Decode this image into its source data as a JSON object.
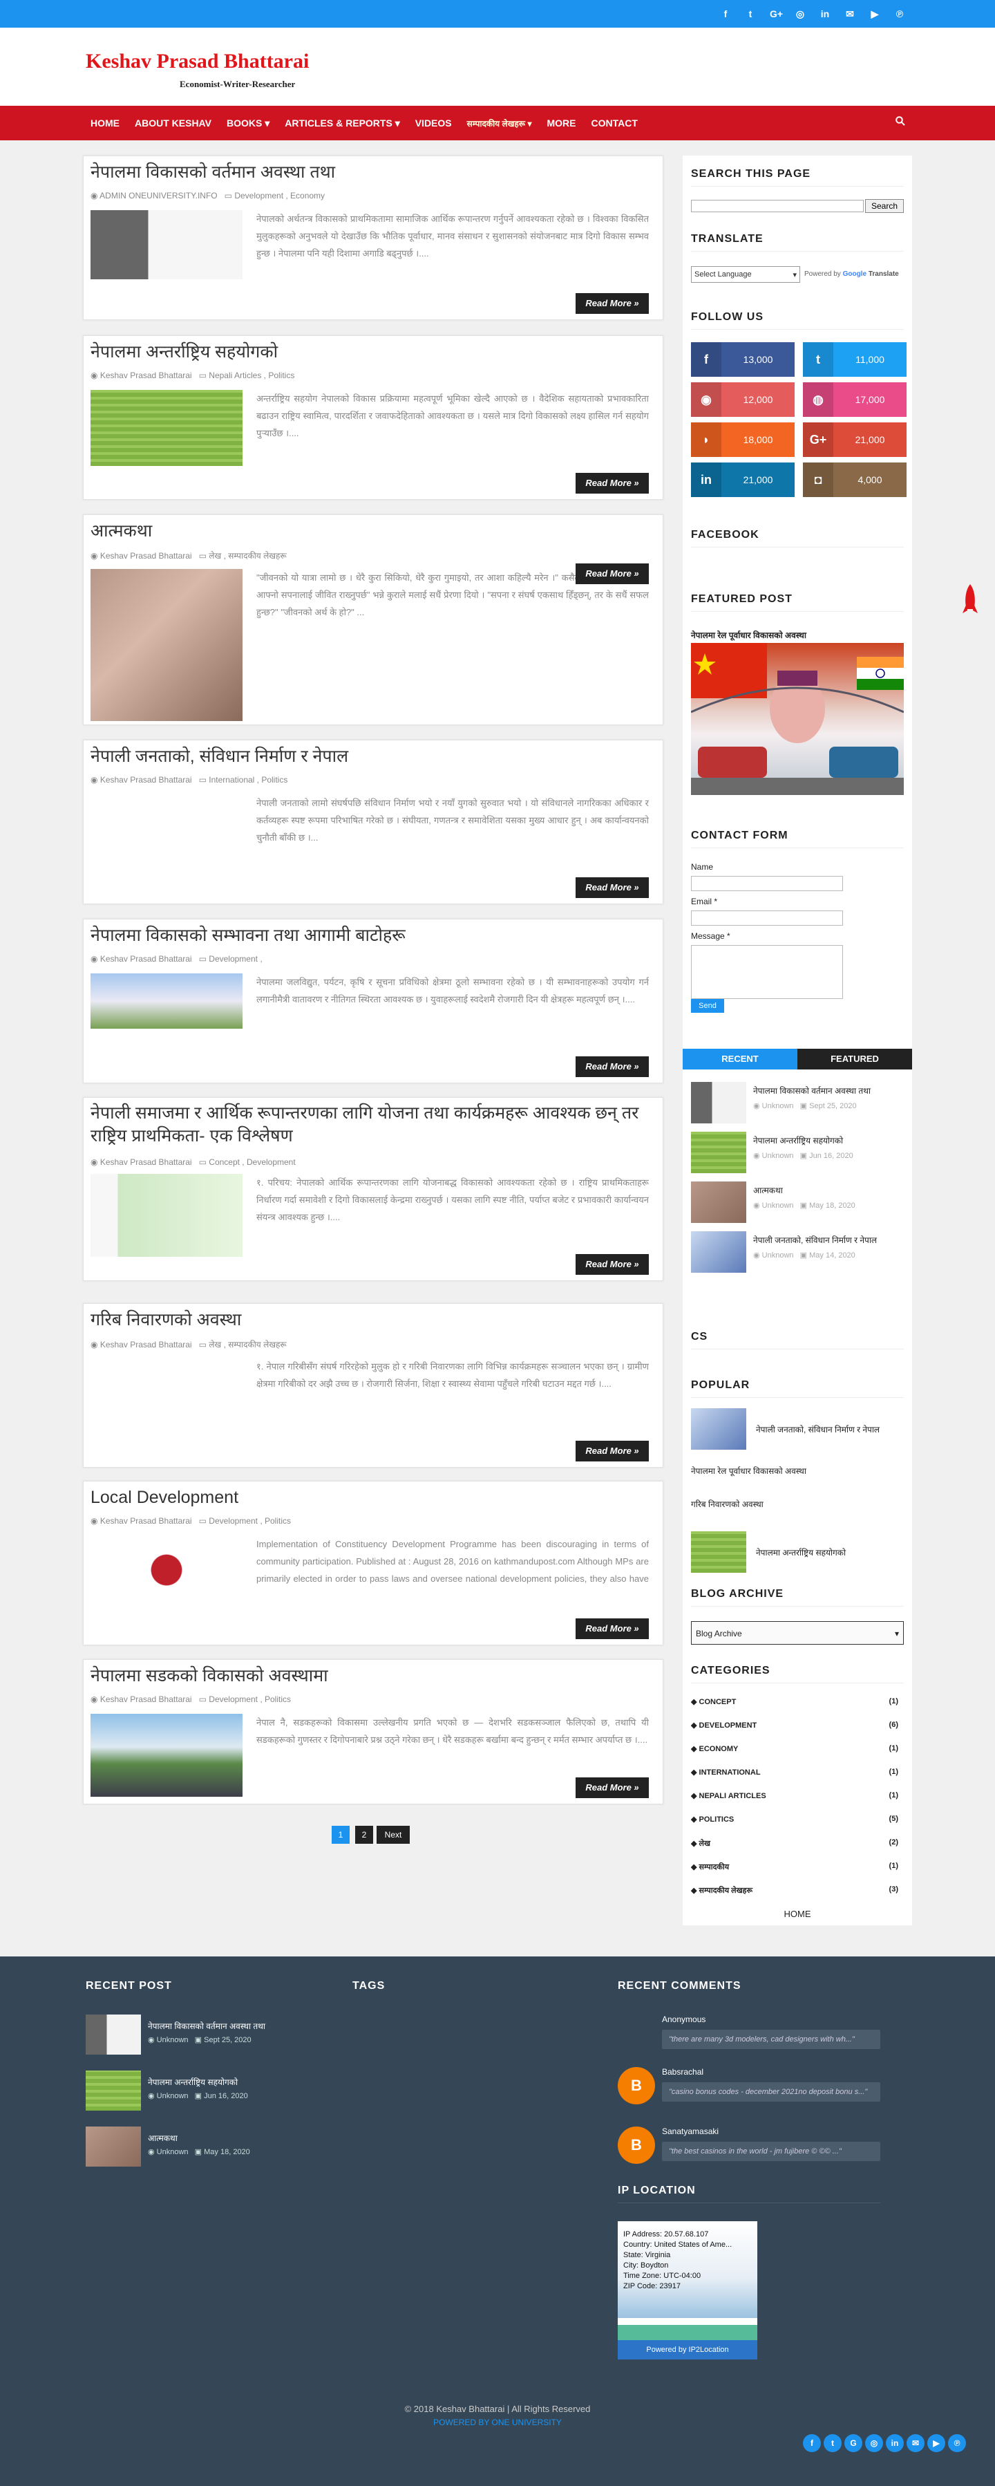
{
  "site": {
    "title": "Keshav Prasad Bhattarai",
    "subtitle": "Economist-Writer-Researcher"
  },
  "topbar_icons": [
    "facebook-icon",
    "twitter-icon",
    "google-plus-icon",
    "instagram-icon",
    "linkedin-icon",
    "email-icon",
    "youtube-icon",
    "pinterest-icon"
  ],
  "nav": [
    "HOME",
    "ABOUT KESHAV",
    "BOOKS ▾",
    "ARTICLES & REPORTS ▾",
    "VIDEOS",
    "सम्पादकीय लेखहरू ▾",
    "MORE",
    "CONTACT"
  ],
  "posts": [
    {
      "title": "नेपालमा विकासको वर्तमान अवस्था तथा",
      "meta_author": "ADMIN ONEUNIVERSITY.INFO",
      "meta_labels": "Development , Economy",
      "excerpt": "नेपालको अर्थतन्त्र विकासको प्राथमिकतामा सामाजिक आर्थिक रूपान्तरण गर्नुपर्ने आवश्यकता रहेको छ । विश्वका विकसित मुलुकहरूको अनुभवले यो देखाउँछ कि भौतिक पूर्वाधार, मानव संसाधन र सुशासनको संयोजनबाट मात्र दिगो विकास सम्भव हुन्छ । नेपालमा पनि यही दिशामा अगाडि बढ्नुपर्छ ।....",
      "read": "Read More »"
    },
    {
      "title": "नेपालमा अन्तर्राष्ट्रिय सहयोगको",
      "meta_author": "Keshav Prasad Bhattarai",
      "meta_labels": "Nepali Articles , Politics",
      "excerpt": "अन्तर्राष्ट्रिय सहयोग नेपालको विकास प्रक्रियामा महत्वपूर्ण भूमिका खेल्दै आएको छ । वैदेशिक सहायताको प्रभावकारिता बढाउन राष्ट्रिय स्वामित्व, पारदर्शिता र जवाफदेहिताको आवश्यकता छ । यसले मात्र दिगो विकासको लक्ष्य हासिल गर्न सहयोग पुर्‍याउँछ ।....",
      "read": "Read More »"
    },
    {
      "title": "आत्मकथा",
      "meta_author": "Keshav Prasad Bhattarai",
      "meta_labels": "लेख , सम्पादकीय लेखहरू",
      "excerpt": "\"जीवनको यो यात्रा लामो छ । धेरै कुरा सिकियो, धेरै कुरा गुमाइयो, तर आशा कहिल्यै मरेन ।\" कसैले भनेका थिए । \"हामी आफ्नो सपनालाई जीवित राख्नुपर्छ\" भन्ने कुराले मलाई सधैं प्रेरणा दियो । \"सपना र संघर्ष एकसाथ हिँड्छन्, तर के सधैं सफल हुन्छ?\" \"जीवनको अर्थ के हो?\" ...",
      "read": "Read More »"
    },
    {
      "title": "नेपाली जनताको, संविधान निर्माण र नेपाल",
      "meta_author": "Keshav Prasad Bhattarai",
      "meta_labels": "International , Politics",
      "excerpt": "नेपाली जनताको लामो संघर्षपछि संविधान निर्माण भयो र नयाँ युगको सुरुवात भयो । यो संविधानले नागरिकका अधिकार र कर्तव्यहरू स्पष्ट रूपमा परिभाषित गरेको छ । संघीयता, गणतन्त्र र समावेशिता यसका मुख्य आधार हुन् । अब कार्यान्वयनको चुनौती बाँकी छ ।...",
      "read": "Read More »"
    },
    {
      "title": "नेपालमा विकासको सम्भावना तथा आगामी बाटोहरू",
      "meta_author": "Keshav Prasad Bhattarai",
      "meta_labels": "Development ,",
      "excerpt": "नेपालमा जलविद्युत, पर्यटन, कृषि र सूचना प्रविधिको क्षेत्रमा ठूलो सम्भावना रहेको छ । यी सम्भावनाहरूको उपयोग गर्न लगानीमैत्री वातावरण र नीतिगत स्थिरता आवश्यक छ । युवाहरूलाई स्वदेशमै रोजगारी दिन यी क्षेत्रहरू महत्वपूर्ण छन् ।....",
      "read": "Read More »"
    },
    {
      "title": "नेपाली समाजमा र आर्थिक रूपान्तरणका लागि योजना तथा कार्यक्रमहरू आवश्यक छन् तर राष्ट्रिय प्राथमिकता- एक विश्लेषण",
      "meta_author": "Keshav Prasad Bhattarai",
      "meta_labels": "Concept , Development",
      "excerpt": "१. परिचय: नेपालको आर्थिक रूपान्तरणका लागि योजनाबद्ध विकासको आवश्यकता रहेको छ । राष्ट्रिय प्राथमिकताहरू निर्धारण गर्दा समावेशी र दिगो विकासलाई केन्द्रमा राख्नुपर्छ । यसका लागि स्पष्ट नीति, पर्याप्त बजेट र प्रभावकारी कार्यान्वयन संयन्त्र आवश्यक हुन्छ ।....",
      "read": "Read More »"
    },
    {
      "title": "गरिब निवारणको अवस्था",
      "meta_author": "Keshav Prasad Bhattarai",
      "meta_labels": "लेख , सम्पादकीय लेखहरू",
      "excerpt": "१. नेपाल गरिबीसँग संघर्ष गरिरहेको मुलुक हो र गरिबी निवारणका लागि विभिन्न कार्यक्रमहरू सञ्चालन भएका छन् । ग्रामीण क्षेत्रमा गरिबीको दर अझै उच्च छ । रोजगारी सिर्जना, शिक्षा र स्वास्थ्य सेवामा पहुँचले गरिबी घटाउन मद्दत गर्छ ।....",
      "read": "Read More »"
    },
    {
      "title": "Local Development",
      "meta_author": "Keshav Prasad Bhattarai",
      "meta_labels": "Development , Politics",
      "excerpt": "Implementation of Constituency Development Programme has been discouraging in terms of community participation. Published at : August 28, 2016 on kathmandupost.com Although MPs are primarily elected in order to pass laws and oversee national development policies, they also have some local responsibilities.....",
      "read": "Read More »"
    },
    {
      "title": "नेपालमा सडकको विकासको अवस्थामा",
      "meta_author": "Keshav Prasad Bhattarai",
      "meta_labels": "Development , Politics",
      "excerpt": "नेपाल नै, सडकहरूको विकासमा उल्लेखनीय प्रगति भएको छ — देशभरि सडकसञ्जाल फैलिएको छ, तथापि यी सडकहरूको गुणस्तर र दिगोपनाबारे प्रश्न उठ्ने गरेका छन् । धेरै सडकहरू बर्खामा बन्द हुन्छन् र मर्मत सम्भार अपर्याप्त छ ।....",
      "read": "Read More »"
    }
  ],
  "sidebar": {
    "search_title": "SEARCH THIS PAGE",
    "search_button": "Search",
    "translate_title": "TRANSLATE",
    "translate_select": "Select Language",
    "translate_powered": "Powered by",
    "translate_google": "Google",
    "translate_word": "Translate",
    "follow_title": "FOLLOW US",
    "follow": [
      {
        "icon": "facebook-icon",
        "glyph": "f",
        "count": "13,000",
        "color": "#3b5998"
      },
      {
        "icon": "twitter-icon",
        "glyph": "t",
        "count": "11,000",
        "color": "#1da1f2"
      },
      {
        "icon": "rss-icon",
        "glyph": "◉",
        "count": "12,000",
        "color": "#e55c5c"
      },
      {
        "icon": "dribbble-icon",
        "glyph": "◍",
        "count": "17,000",
        "color": "#ea4c89"
      },
      {
        "icon": "rss-icon",
        "glyph": "◗",
        "count": "18,000",
        "color": "#f26522"
      },
      {
        "icon": "google-plus-icon",
        "glyph": "G+",
        "count": "21,000",
        "color": "#dd4b39"
      },
      {
        "icon": "linkedin-icon",
        "glyph": "in",
        "count": "21,000",
        "color": "#0e76a8"
      },
      {
        "icon": "instagram-icon",
        "glyph": "◘",
        "count": "4,000",
        "color": "#8a6948"
      }
    ],
    "facebook_title": "FACEBOOK",
    "featured_title": "FEATURED POST",
    "featured_post_title": "नेपालमा रेल पूर्वाधार विकासको अवस्था",
    "contact_title": "CONTACT FORM",
    "contact_name": "Name",
    "contact_email": "Email *",
    "contact_message": "Message *",
    "contact_send": "Send",
    "tab_recent": "RECENT",
    "tab_featured": "FEATURED",
    "recent": [
      {
        "title": "नेपालमा विकासको वर्तमान अवस्था तथा",
        "author": "Unknown",
        "date": "Sept 25, 2020"
      },
      {
        "title": "नेपालमा अन्तर्राष्ट्रिय सहयोगको",
        "author": "Unknown",
        "date": "Jun 16, 2020"
      },
      {
        "title": "आत्मकथा",
        "author": "Unknown",
        "date": "May 18, 2020"
      },
      {
        "title": "नेपाली जनताको, संविधान निर्माण र नेपाल",
        "author": "Unknown",
        "date": "May 14, 2020"
      }
    ],
    "cs_title": "CS",
    "popular_title": "POPULAR",
    "popular": [
      "नेपाली जनताको, संविधान निर्माण र नेपाल",
      "नेपालमा रेल पूर्वाधार विकासको अवस्था",
      "गरिब निवारणको अवस्था",
      "नेपालमा अन्तर्राष्ट्रिय सहयोगको"
    ],
    "archive_title": "BLOG ARCHIVE",
    "archive_select": "Blog Archive",
    "categories_title": "CATEGORIES",
    "categories": [
      {
        "name": "CONCEPT",
        "count": "(1)"
      },
      {
        "name": "DEVELOPMENT",
        "count": "(6)"
      },
      {
        "name": "ECONOMY",
        "count": "(1)"
      },
      {
        "name": "INTERNATIONAL",
        "count": "(1)"
      },
      {
        "name": "NEPALI ARTICLES",
        "count": "(1)"
      },
      {
        "name": "POLITICS",
        "count": "(5)"
      },
      {
        "name": "लेख",
        "count": "(2)"
      },
      {
        "name": "सम्पादकीय",
        "count": "(1)"
      },
      {
        "name": "सम्पादकीय लेखहरू",
        "count": "(3)"
      }
    ],
    "home_link": "HOME"
  },
  "pagination": {
    "p1": "1",
    "p2": "2",
    "next": "Next"
  },
  "footer": {
    "recent_title": "RECENT POST",
    "tags_title": "TAGS",
    "comments_title": "RECENT COMMENTS",
    "recent": [
      {
        "title": "नेपालमा विकासको वर्तमान अवस्था तथा",
        "author": "Unknown",
        "date": "Sept 25, 2020"
      },
      {
        "title": "नेपालमा अन्तर्राष्ट्रिय सहयोगको",
        "author": "Unknown",
        "date": "Jun 16, 2020"
      },
      {
        "title": "आत्मकथा",
        "author": "Unknown",
        "date": "May 18, 2020"
      }
    ],
    "comments": [
      {
        "name": "Anonymous",
        "text": "\"there are many 3d modelers, cad designers with wh...\""
      },
      {
        "name": "Babsrachal",
        "text": "\"casino bonus codes - december 2021no deposit bonu s...\""
      },
      {
        "name": "Sanatyamasaki",
        "text": "\"the best casinos in the world - jm fujibere © ©© ...\""
      }
    ],
    "ip_title": "IP LOCATION",
    "ip_lines": [
      "IP Address: 20.57.68.107",
      "Country: United States of Ame...",
      "State: Virginia",
      "City: Boydton",
      "Time Zone: UTC-04:00",
      "ZIP Code: 23917"
    ],
    "ip_powered": "Powered by IP2Location",
    "copyright": "© 2018 Keshav Bhattarai | All Rights Reserved",
    "powered": "POWERED BY ONE UNIVERSITY"
  },
  "colors": {
    "accent": "#1c93ef",
    "nav": "#cf1421",
    "footer": "#354656",
    "brand_red": "#e0161a"
  }
}
